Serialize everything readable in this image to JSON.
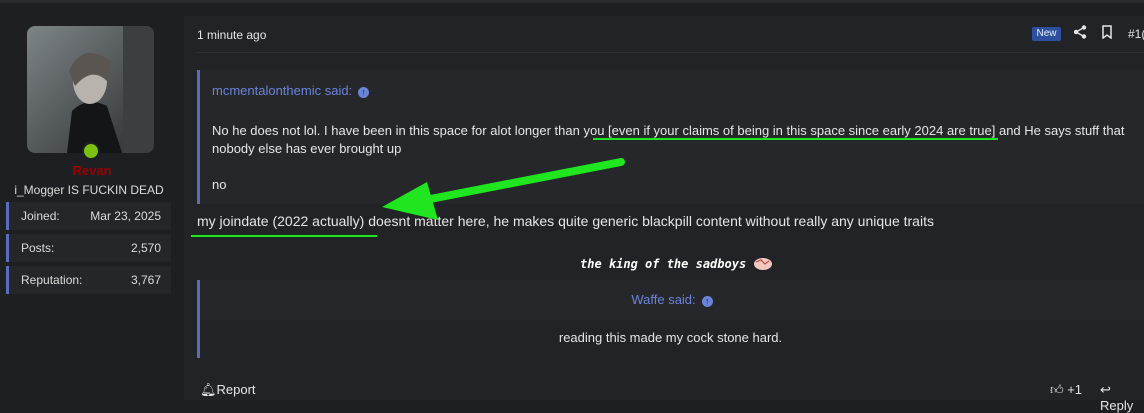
{
  "author": {
    "username": "Revan",
    "user_title": "i_Mogger IS FUCKIN DEAD",
    "stats": [
      {
        "label": "Joined:",
        "value": "Mar 23, 2025"
      },
      {
        "label": "Posts:",
        "value": "2,570"
      },
      {
        "label": "Reputation:",
        "value": "3,767"
      }
    ]
  },
  "post": {
    "timestamp": "1 minute ago",
    "new_badge": "New",
    "number": "#1(",
    "quote1": {
      "author": "mcmentalonthemic said:",
      "lines": [
        "No he does not lol. I have been in this space for alot longer than you [even if your claims of being in this space since early 2024 are true] and He says stuff that",
        "nobody else has ever brought up",
        "",
        "no"
      ]
    },
    "reply": "my joindate (2022 actually) doesnt matter here, he makes quite generic blackpill content without really any unique traits",
    "signature": "the king of the sadboys",
    "quote2": {
      "author": "Waffe said:",
      "body": "reading this made my cock stone hard."
    },
    "footer": {
      "report": "Report",
      "likes": "+1",
      "reply": "Reply"
    }
  },
  "annotation_color": "#1fe61f"
}
